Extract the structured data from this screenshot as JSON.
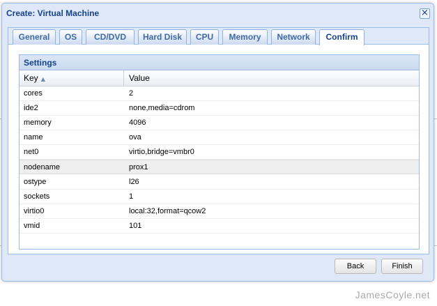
{
  "window": {
    "title": "Create: Virtual Machine"
  },
  "tabs": [
    {
      "label": "General"
    },
    {
      "label": "OS"
    },
    {
      "label": "CD/DVD"
    },
    {
      "label": "Hard Disk"
    },
    {
      "label": "CPU"
    },
    {
      "label": "Memory"
    },
    {
      "label": "Network"
    },
    {
      "label": "Confirm",
      "active": true
    }
  ],
  "settings": {
    "title": "Settings",
    "columns": {
      "key": "Key",
      "value": "Value"
    },
    "rows": [
      {
        "key": "cores",
        "value": "2"
      },
      {
        "key": "ide2",
        "value": "none,media=cdrom"
      },
      {
        "key": "memory",
        "value": "4096"
      },
      {
        "key": "name",
        "value": "ova"
      },
      {
        "key": "net0",
        "value": "virtio,bridge=vmbr0"
      },
      {
        "key": "nodename",
        "value": "prox1"
      },
      {
        "key": "ostype",
        "value": "l26"
      },
      {
        "key": "sockets",
        "value": "1"
      },
      {
        "key": "virtio0",
        "value": "local:32,format=qcow2"
      },
      {
        "key": "vmid",
        "value": "101"
      }
    ]
  },
  "buttons": {
    "back": "Back",
    "finish": "Finish"
  },
  "close_symbol": "×",
  "sort_symbol": "▲",
  "watermark": "JamesCoyle.net"
}
